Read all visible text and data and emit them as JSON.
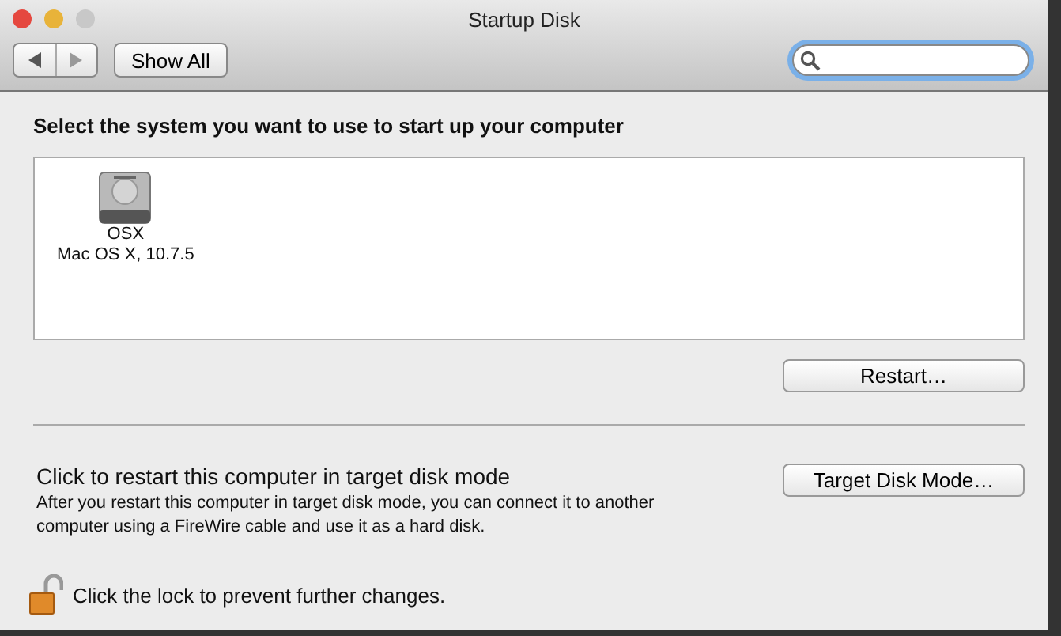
{
  "window": {
    "title": "Startup Disk"
  },
  "toolbar": {
    "show_all": "Show All",
    "search": {
      "focused": true
    }
  },
  "heading": "Select the system you want to use to start up your computer",
  "disks": [
    {
      "name": "OSX",
      "version": "Mac OS X, 10.7.5"
    }
  ],
  "restart_button": "Restart…",
  "target_mode": {
    "title": "Click to restart this computer in target disk mode",
    "description": "After you restart this computer in target disk mode, you can connect it to another computer using a FireWire cable and use it as a hard disk.",
    "button": "Target Disk Mode…"
  },
  "lock": {
    "locked": false,
    "label": "Click the lock to prevent further changes."
  }
}
